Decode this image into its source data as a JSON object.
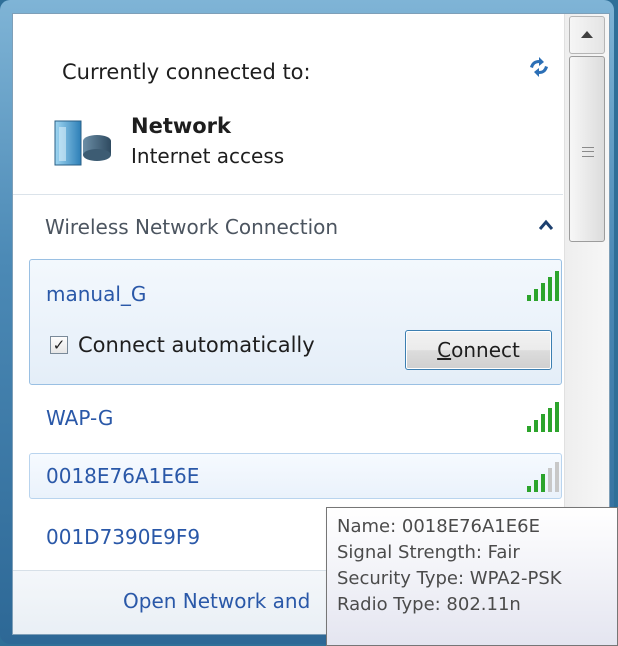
{
  "header": {
    "connected_label": "Currently connected to:",
    "network_name": "Network",
    "network_status": "Internet access"
  },
  "wireless": {
    "section_label": "Wireless Network Connection",
    "networks": [
      {
        "ssid": "manual_G",
        "signal_bars": 5,
        "expanded": true,
        "connect_automatically_label": "Connect automatically",
        "connect_automatically_checked": true,
        "connect_button_label": "Connect",
        "connect_button_accel": "C",
        "connect_button_rest": "onnect"
      },
      {
        "ssid": "WAP-G",
        "signal_bars": 5
      },
      {
        "ssid": "0018E76A1E6E",
        "signal_bars": 3
      },
      {
        "ssid": "001D7390E9F9"
      }
    ]
  },
  "footer": {
    "link_label": "Open Network and"
  },
  "tooltip": {
    "line1": "Name: 0018E76A1E6E",
    "line2": "Signal Strength: Fair",
    "line3": "Security Type: WPA2-PSK",
    "line4": "Radio Type: 802.11n"
  },
  "colors": {
    "link": "#2a58a8",
    "signal_active": "#2ca42c",
    "signal_inactive": "#c8c8c8",
    "frame": "#4c8ab6"
  },
  "icons": {
    "refresh": "refresh-icon",
    "network": "network-computer-icon",
    "collapse": "chevron-up-icon",
    "signal": "signal-strength-icon",
    "scroll_up": "scroll-up-arrow-icon"
  }
}
